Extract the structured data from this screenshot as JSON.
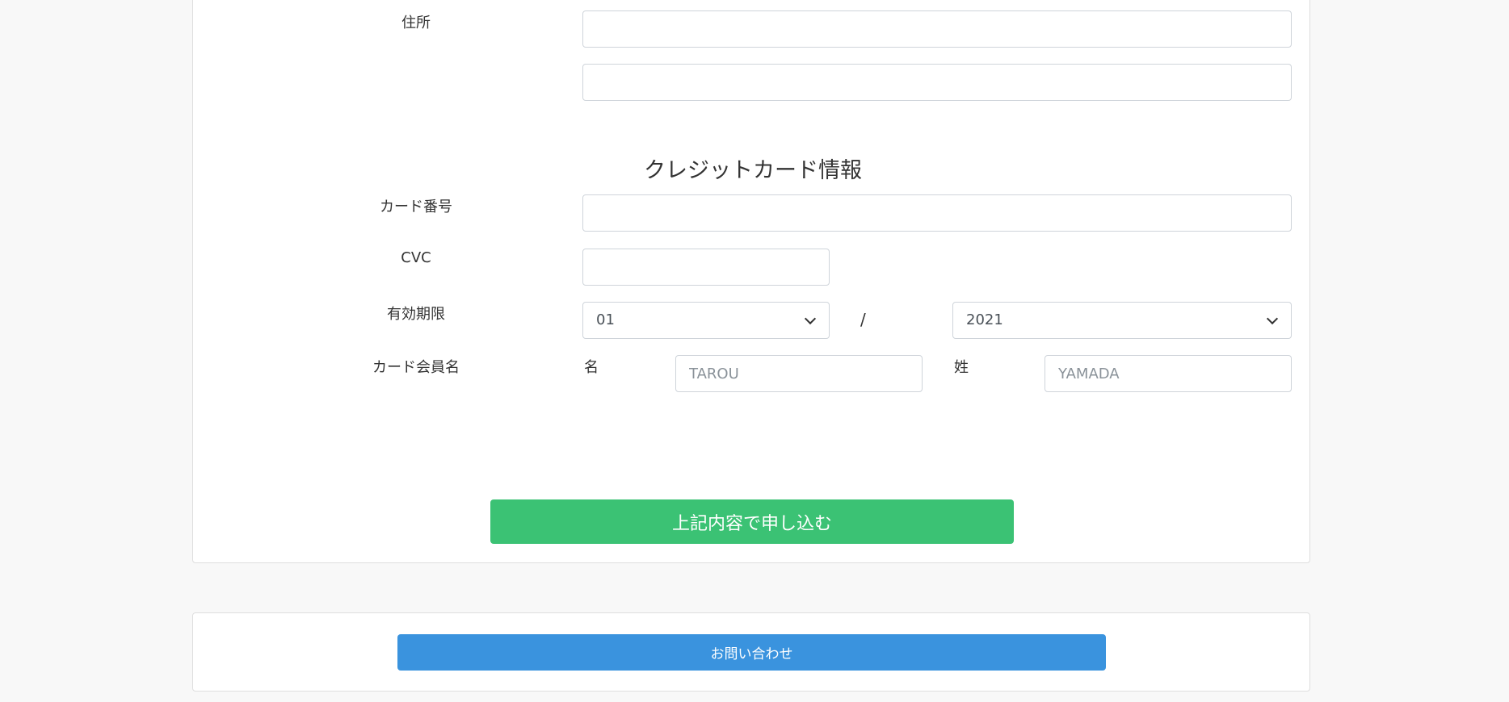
{
  "address": {
    "label": "住所",
    "line1_value": "",
    "line2_value": ""
  },
  "credit_card": {
    "section_title": "クレジットカード情報",
    "card_number_label": "カード番号",
    "card_number_value": "",
    "cvc_label": "CVC",
    "cvc_value": "",
    "expiry_label": "有効期限",
    "expiry_month": "01",
    "expiry_separator": "/",
    "expiry_year": "2021",
    "holder_label": "カード会員名",
    "first_name_label": "名",
    "first_name_placeholder": "TAROU",
    "last_name_label": "姓",
    "last_name_placeholder": "YAMADA"
  },
  "actions": {
    "submit_label": "上記内容で申し込む",
    "contact_label": "お問い合わせ"
  },
  "colors": {
    "submit_button": "#3bc274",
    "contact_button": "#3a93de",
    "page_background": "#f8f8f8"
  },
  "icons": {
    "select_arrow": "chevron-down-icon"
  }
}
